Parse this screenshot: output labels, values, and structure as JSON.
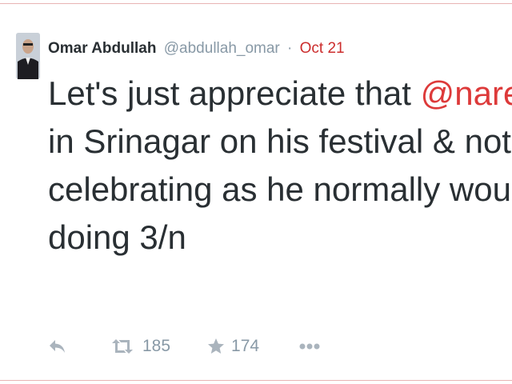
{
  "tweet": {
    "author_name": "Omar Abdullah",
    "handle": "@abdullah_omar",
    "separator": "·",
    "date": "Oct 21",
    "text_lines": [
      {
        "before": "Let's just appreciate that ",
        "mention": "@narendram",
        "after": ""
      },
      {
        "before": "in Srinagar on his festival & not at hom",
        "mention": "",
        "after": ""
      },
      {
        "before": "celebrating as he normally would have",
        "mention": "",
        "after": ""
      },
      {
        "before": "doing 3/n",
        "mention": "",
        "after": ""
      }
    ]
  },
  "actions": {
    "reply_icon": "reply-icon",
    "retweet_icon": "retweet-icon",
    "retweet_count": "185",
    "favorite_icon": "star-icon",
    "favorite_count": "174",
    "more_icon": "more-dots-icon"
  },
  "colors": {
    "mention": "#dd3a3a",
    "date": "#cc2d2d",
    "text": "#292f33",
    "muted": "#8899a6"
  }
}
